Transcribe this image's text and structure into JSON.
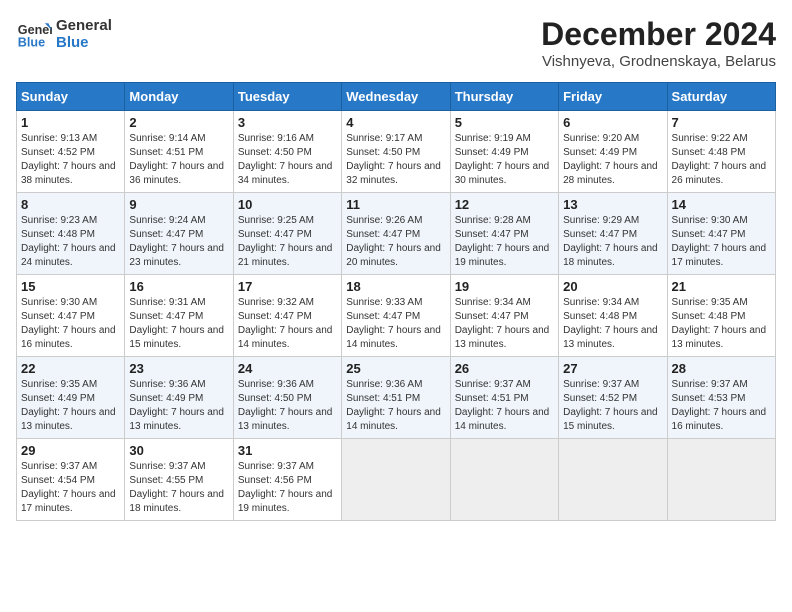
{
  "header": {
    "logo_line1": "General",
    "logo_line2": "Blue",
    "month_title": "December 2024",
    "location": "Vishnyeva, Grodnenskaya, Belarus"
  },
  "days_of_week": [
    "Sunday",
    "Monday",
    "Tuesday",
    "Wednesday",
    "Thursday",
    "Friday",
    "Saturday"
  ],
  "weeks": [
    [
      {
        "day": "1",
        "sunrise": "9:13 AM",
        "sunset": "4:52 PM",
        "daylight": "7 hours and 38 minutes."
      },
      {
        "day": "2",
        "sunrise": "9:14 AM",
        "sunset": "4:51 PM",
        "daylight": "7 hours and 36 minutes."
      },
      {
        "day": "3",
        "sunrise": "9:16 AM",
        "sunset": "4:50 PM",
        "daylight": "7 hours and 34 minutes."
      },
      {
        "day": "4",
        "sunrise": "9:17 AM",
        "sunset": "4:50 PM",
        "daylight": "7 hours and 32 minutes."
      },
      {
        "day": "5",
        "sunrise": "9:19 AM",
        "sunset": "4:49 PM",
        "daylight": "7 hours and 30 minutes."
      },
      {
        "day": "6",
        "sunrise": "9:20 AM",
        "sunset": "4:49 PM",
        "daylight": "7 hours and 28 minutes."
      },
      {
        "day": "7",
        "sunrise": "9:22 AM",
        "sunset": "4:48 PM",
        "daylight": "7 hours and 26 minutes."
      }
    ],
    [
      {
        "day": "8",
        "sunrise": "9:23 AM",
        "sunset": "4:48 PM",
        "daylight": "7 hours and 24 minutes."
      },
      {
        "day": "9",
        "sunrise": "9:24 AM",
        "sunset": "4:47 PM",
        "daylight": "7 hours and 23 minutes."
      },
      {
        "day": "10",
        "sunrise": "9:25 AM",
        "sunset": "4:47 PM",
        "daylight": "7 hours and 21 minutes."
      },
      {
        "day": "11",
        "sunrise": "9:26 AM",
        "sunset": "4:47 PM",
        "daylight": "7 hours and 20 minutes."
      },
      {
        "day": "12",
        "sunrise": "9:28 AM",
        "sunset": "4:47 PM",
        "daylight": "7 hours and 19 minutes."
      },
      {
        "day": "13",
        "sunrise": "9:29 AM",
        "sunset": "4:47 PM",
        "daylight": "7 hours and 18 minutes."
      },
      {
        "day": "14",
        "sunrise": "9:30 AM",
        "sunset": "4:47 PM",
        "daylight": "7 hours and 17 minutes."
      }
    ],
    [
      {
        "day": "15",
        "sunrise": "9:30 AM",
        "sunset": "4:47 PM",
        "daylight": "7 hours and 16 minutes."
      },
      {
        "day": "16",
        "sunrise": "9:31 AM",
        "sunset": "4:47 PM",
        "daylight": "7 hours and 15 minutes."
      },
      {
        "day": "17",
        "sunrise": "9:32 AM",
        "sunset": "4:47 PM",
        "daylight": "7 hours and 14 minutes."
      },
      {
        "day": "18",
        "sunrise": "9:33 AM",
        "sunset": "4:47 PM",
        "daylight": "7 hours and 14 minutes."
      },
      {
        "day": "19",
        "sunrise": "9:34 AM",
        "sunset": "4:47 PM",
        "daylight": "7 hours and 13 minutes."
      },
      {
        "day": "20",
        "sunrise": "9:34 AM",
        "sunset": "4:48 PM",
        "daylight": "7 hours and 13 minutes."
      },
      {
        "day": "21",
        "sunrise": "9:35 AM",
        "sunset": "4:48 PM",
        "daylight": "7 hours and 13 minutes."
      }
    ],
    [
      {
        "day": "22",
        "sunrise": "9:35 AM",
        "sunset": "4:49 PM",
        "daylight": "7 hours and 13 minutes."
      },
      {
        "day": "23",
        "sunrise": "9:36 AM",
        "sunset": "4:49 PM",
        "daylight": "7 hours and 13 minutes."
      },
      {
        "day": "24",
        "sunrise": "9:36 AM",
        "sunset": "4:50 PM",
        "daylight": "7 hours and 13 minutes."
      },
      {
        "day": "25",
        "sunrise": "9:36 AM",
        "sunset": "4:51 PM",
        "daylight": "7 hours and 14 minutes."
      },
      {
        "day": "26",
        "sunrise": "9:37 AM",
        "sunset": "4:51 PM",
        "daylight": "7 hours and 14 minutes."
      },
      {
        "day": "27",
        "sunrise": "9:37 AM",
        "sunset": "4:52 PM",
        "daylight": "7 hours and 15 minutes."
      },
      {
        "day": "28",
        "sunrise": "9:37 AM",
        "sunset": "4:53 PM",
        "daylight": "7 hours and 16 minutes."
      }
    ],
    [
      {
        "day": "29",
        "sunrise": "9:37 AM",
        "sunset": "4:54 PM",
        "daylight": "7 hours and 17 minutes."
      },
      {
        "day": "30",
        "sunrise": "9:37 AM",
        "sunset": "4:55 PM",
        "daylight": "7 hours and 18 minutes."
      },
      {
        "day": "31",
        "sunrise": "9:37 AM",
        "sunset": "4:56 PM",
        "daylight": "7 hours and 19 minutes."
      },
      null,
      null,
      null,
      null
    ]
  ]
}
